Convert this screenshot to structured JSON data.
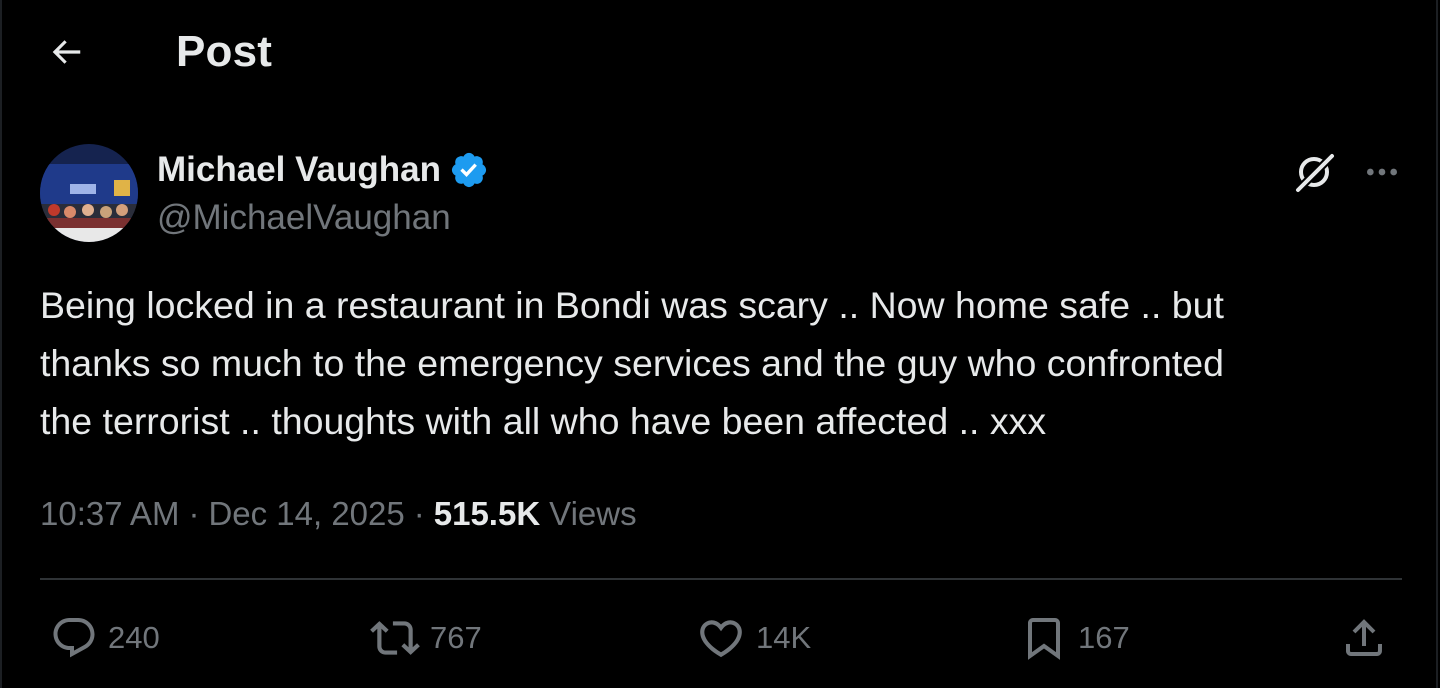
{
  "header": {
    "title": "Post",
    "back_icon": "arrow-left-icon"
  },
  "author": {
    "name": "Michael Vaughan",
    "handle": "@MichaelVaughan",
    "verified": true,
    "verified_color": "#1d9bf0"
  },
  "post": {
    "text": "Being locked in a restaurant in Bondi was scary .. Now home safe .. but\nthanks so much to the emergency services and the guy who confronted\nthe terrorist .. thoughts with all who have been affected .. xxx",
    "time": "10:37 AM",
    "date": "Dec 14, 2025",
    "separator": "·",
    "views_count": "515.5K",
    "views_label": "Views"
  },
  "actions": {
    "replies": "240",
    "reposts": "767",
    "likes": "14K",
    "bookmarks": "167"
  },
  "colors": {
    "background": "#000000",
    "text_primary": "#e7e9ea",
    "text_secondary": "#71767b",
    "divider": "#2f3336",
    "accent": "#1d9bf0"
  }
}
